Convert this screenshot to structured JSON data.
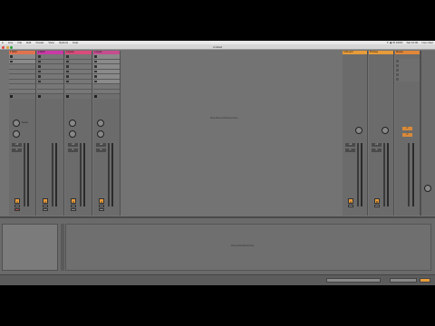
{
  "menubar": {
    "apple": "",
    "items": [
      "Live",
      "File",
      "Edit",
      "Create",
      "View",
      "Options",
      "Help"
    ],
    "right": [
      "✦ ◉ ⚙ 100%",
      "Sat 12:00",
      "Live User"
    ]
  },
  "window": {
    "title": "Untitled"
  },
  "tracks": [
    {
      "name": "1 MIDI",
      "header_color": "#e0734f",
      "number": "1",
      "vol": "-inf",
      "pan": "C"
    },
    {
      "name": "2 MIDI",
      "header_color": "#c93aa6",
      "number": "2",
      "vol": "-inf",
      "pan": "C"
    },
    {
      "name": "3 Audio",
      "header_color": "#d84b7a",
      "number": "3",
      "vol": "-inf",
      "pan": "C"
    },
    {
      "name": "4 Audio",
      "header_color": "#c54d8f",
      "number": "4",
      "vol": "-inf",
      "pan": "C"
    }
  ],
  "returns": [
    {
      "name": "A Reverb",
      "header_color": "#e79b3a",
      "number": "A"
    },
    {
      "name": "B Delay",
      "header_color": "#e79b3a",
      "number": "B"
    }
  ],
  "master": {
    "name": "Master",
    "header_color": "#e0873a"
  },
  "session_hint": "Drop Files and Devices Here",
  "sends_label": "Sends",
  "detail_hint": "Drop Audio Effects Here",
  "colors": {
    "menubar_bg": "#e8e8e8",
    "session_bg": "#737373",
    "track_bg": "#6b6b6b",
    "track_number_orange": "#e79b3a",
    "arm_red": "#b8484b"
  }
}
